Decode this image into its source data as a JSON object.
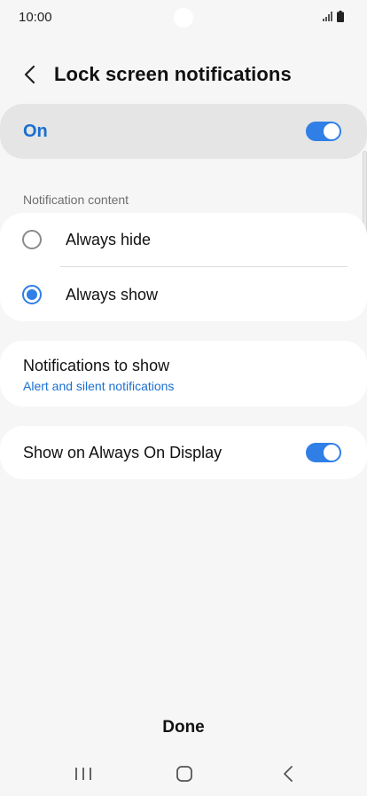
{
  "status_bar": {
    "time": "10:00",
    "icons": [
      "signal-icon",
      "battery-icon"
    ]
  },
  "header": {
    "back_icon": "chevron-left-icon",
    "title": "Lock screen notifications"
  },
  "master": {
    "label": "On",
    "toggle_on": true
  },
  "notification_content": {
    "section_label": "Notification content",
    "options": [
      {
        "label": "Always hide",
        "selected": false
      },
      {
        "label": "Always show",
        "selected": true
      }
    ]
  },
  "notifications_to_show": {
    "title": "Notifications to show",
    "value": "Alert and silent notifications"
  },
  "always_on_display": {
    "label": "Show on Always On Display",
    "toggle_on": true
  },
  "footer": {
    "done_label": "Done"
  },
  "nav_bar": {
    "icons": [
      "recent-apps-icon",
      "home-icon",
      "back-icon"
    ]
  },
  "colors": {
    "accent": "#2f7fe6",
    "accent_text": "#1a6fd0",
    "background": "#f6f6f6",
    "card": "#ffffff",
    "master_row": "#e5e5e5"
  }
}
